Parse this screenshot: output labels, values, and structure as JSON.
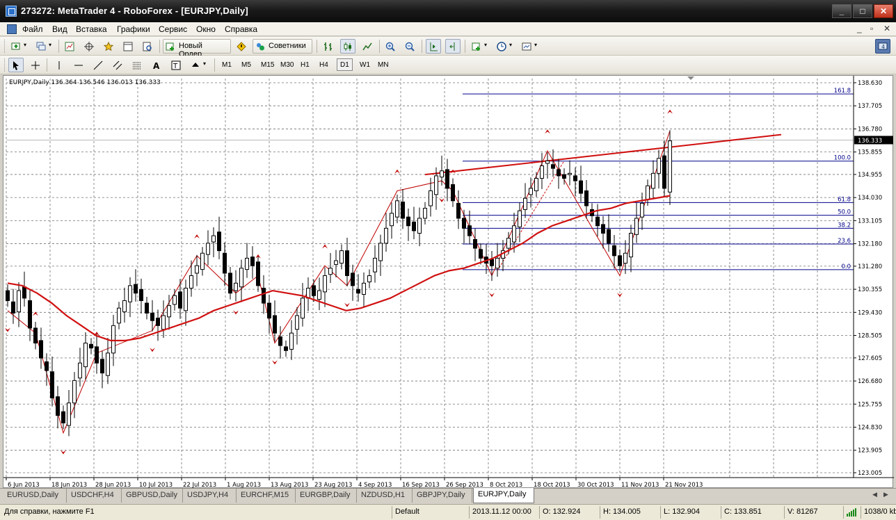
{
  "window": {
    "title": "273272: MetaTrader 4 - RoboForex - [EURJPY,Daily]"
  },
  "menu": [
    "Файл",
    "Вид",
    "Вставка",
    "Графики",
    "Сервис",
    "Окно",
    "Справка"
  ],
  "toolbar": {
    "new_order": "Новый Ордер",
    "advisors": "Советники"
  },
  "timeframes": [
    "M1",
    "M5",
    "M15",
    "M30",
    "H1",
    "H4",
    "D1",
    "W1",
    "MN"
  ],
  "active_timeframe": "D1",
  "chart": {
    "header": "EURJPY,Daily  136.364 136.546 136.013 136.333",
    "current_price": "136.333",
    "price_ticks": [
      "138.630",
      "137.705",
      "136.780",
      "135.855",
      "134.955",
      "134.030",
      "133.105",
      "132.180",
      "131.280",
      "130.355",
      "129.430",
      "128.505",
      "127.605",
      "126.680",
      "125.755",
      "124.830",
      "123.905",
      "123.005"
    ],
    "date_ticks": [
      "6 Jun 2013",
      "18 Jun 2013",
      "28 Jun 2013",
      "10 Jul 2013",
      "22 Jul 2013",
      "1 Aug 2013",
      "13 Aug 2013",
      "23 Aug 2013",
      "4 Sep 2013",
      "16 Sep 2013",
      "26 Sep 2013",
      "8 Oct 2013",
      "18 Oct 2013",
      "30 Oct 2013",
      "11 Nov 2013",
      "21 Nov 2013"
    ],
    "fib_levels": [
      {
        "label": "161.8",
        "price": 138.18
      },
      {
        "label": "100.0",
        "price": 135.49
      },
      {
        "label": "61.8",
        "price": 133.83
      },
      {
        "label": "50.0",
        "price": 133.32
      },
      {
        "label": "38.2",
        "price": 132.8
      },
      {
        "label": "23.6",
        "price": 132.17
      },
      {
        "label": "0.0",
        "price": 131.14
      }
    ],
    "colors": {
      "bull": "#000000",
      "bear": "#000000",
      "ma": "#d01010",
      "zigzag": "#c00000",
      "fib": "#00008b",
      "grid": "#707070"
    }
  },
  "chart_data": {
    "type": "candlestick",
    "symbol": "EURJPY",
    "timeframe": "Daily",
    "ylim": [
      123.005,
      138.63
    ],
    "ohlc_last": {
      "open": 136.364,
      "high": 136.546,
      "low": 136.013,
      "close": 136.333
    },
    "close": [
      129.9,
      129.4,
      130.3,
      130.0,
      128.8,
      128.2,
      127.6,
      127.1,
      126.0,
      125.3,
      125.0,
      125.8,
      126.7,
      127.4,
      128.2,
      128.0,
      127.4,
      127.0,
      127.8,
      128.9,
      129.6,
      129.9,
      130.5,
      130.2,
      129.9,
      129.4,
      129.1,
      128.9,
      129.3,
      129.7,
      130.1,
      129.6,
      130.4,
      130.9,
      131.3,
      131.8,
      132.2,
      132.5,
      131.9,
      131.0,
      130.2,
      130.6,
      131.2,
      131.6,
      131.3,
      130.5,
      129.8,
      129.2,
      128.6,
      128.1,
      127.9,
      128.6,
      129.3,
      130.0,
      130.4,
      130.1,
      130.3,
      130.9,
      131.2,
      131.5,
      131.9,
      130.9,
      130.5,
      130.2,
      130.6,
      130.9,
      131.6,
      132.2,
      132.8,
      133.4,
      133.9,
      133.2,
      132.9,
      132.7,
      133.2,
      133.6,
      134.3,
      134.9,
      135.1,
      134.4,
      133.9,
      133.2,
      132.8,
      132.5,
      132.0,
      131.6,
      131.4,
      131.3,
      131.6,
      131.9,
      132.4,
      132.9,
      133.5,
      134.0,
      134.4,
      134.8,
      135.3,
      135.5,
      135.2,
      134.9,
      134.8,
      135.0,
      134.7,
      134.2,
      133.7,
      133.3,
      132.9,
      132.6,
      132.2,
      131.7,
      131.3,
      131.8,
      132.6,
      133.2,
      133.8,
      134.5,
      135.0,
      135.6,
      134.4,
      136.3
    ],
    "series": [
      {
        "name": "MA",
        "values": [
          130.6,
          130.5,
          130.2,
          129.8,
          129.3,
          128.9,
          128.5,
          128.3,
          128.3,
          128.4,
          128.6,
          128.8,
          129.0,
          129.2,
          129.5,
          129.7,
          129.9,
          130.1,
          130.3,
          130.2,
          130.1,
          129.9,
          129.7,
          129.5,
          129.6,
          129.8,
          130.0,
          130.3,
          130.6,
          130.9,
          131.1,
          131.2,
          131.4,
          131.6,
          131.9,
          132.2,
          132.6,
          132.9,
          133.1,
          133.3,
          133.5,
          133.6,
          133.8,
          133.9,
          134.0,
          134.1
        ]
      }
    ]
  },
  "tabs": [
    "EURUSD,Daily",
    "USDCHF,H4",
    "GBPUSD,Daily",
    "USDJPY,H4",
    "EURCHF,M15",
    "EURGBP,Daily",
    "NZDUSD,H1",
    "GBPJPY,Daily",
    "EURJPY,Daily"
  ],
  "active_tab": "EURJPY,Daily",
  "status": {
    "help": "Для справки, нажмите F1",
    "profile": "Default",
    "datetime": "2013.11.12 00:00",
    "open": "O: 132.924",
    "high": "H: 134.005",
    "low": "L: 132.904",
    "close": "C: 133.851",
    "volume": "V: 81267",
    "traffic": "1038/0 kb"
  }
}
